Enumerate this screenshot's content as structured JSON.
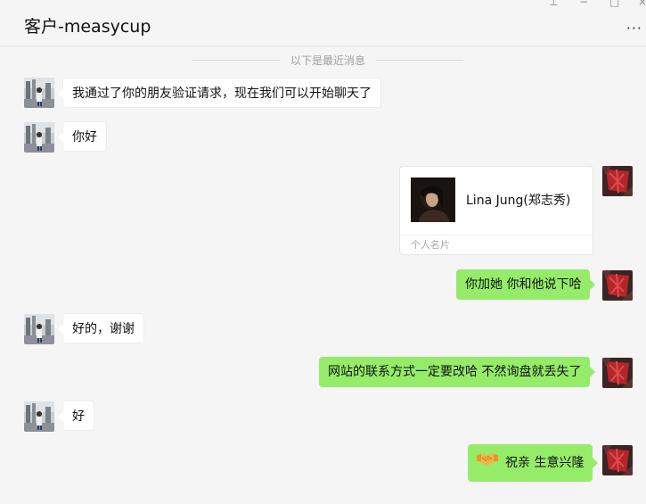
{
  "window": {
    "title": "客户-measycup",
    "more_icon": "···",
    "pin_icon": "⊥",
    "minimize_icon": "−",
    "maximize_icon": "□",
    "close_icon": "×"
  },
  "divider": {
    "text": "以下是最近消息"
  },
  "messages": [
    {
      "side": "left",
      "text": "我通过了你的朋友验证请求，现在我们可以开始聊天了"
    },
    {
      "side": "left",
      "text": "你好"
    },
    {
      "side": "right",
      "type": "contact-card",
      "name": "Lina Jung(郑志秀)",
      "footer": "个人名片"
    },
    {
      "side": "right",
      "text": "你加她 你和他说下哈"
    },
    {
      "side": "left",
      "text": "好的，谢谢"
    },
    {
      "side": "right",
      "text": "网站的联系方式一定要改哈  不然询盘就丢失了"
    },
    {
      "side": "left",
      "text": "好"
    },
    {
      "side": "right",
      "text": "祝亲 生意兴隆",
      "emoji": "handshake-icon"
    }
  ],
  "colors": {
    "background": "#f5f5f5",
    "sent_bubble": "#95ec69",
    "received_bubble": "#ffffff",
    "divider_text": "#9e9e9e"
  }
}
